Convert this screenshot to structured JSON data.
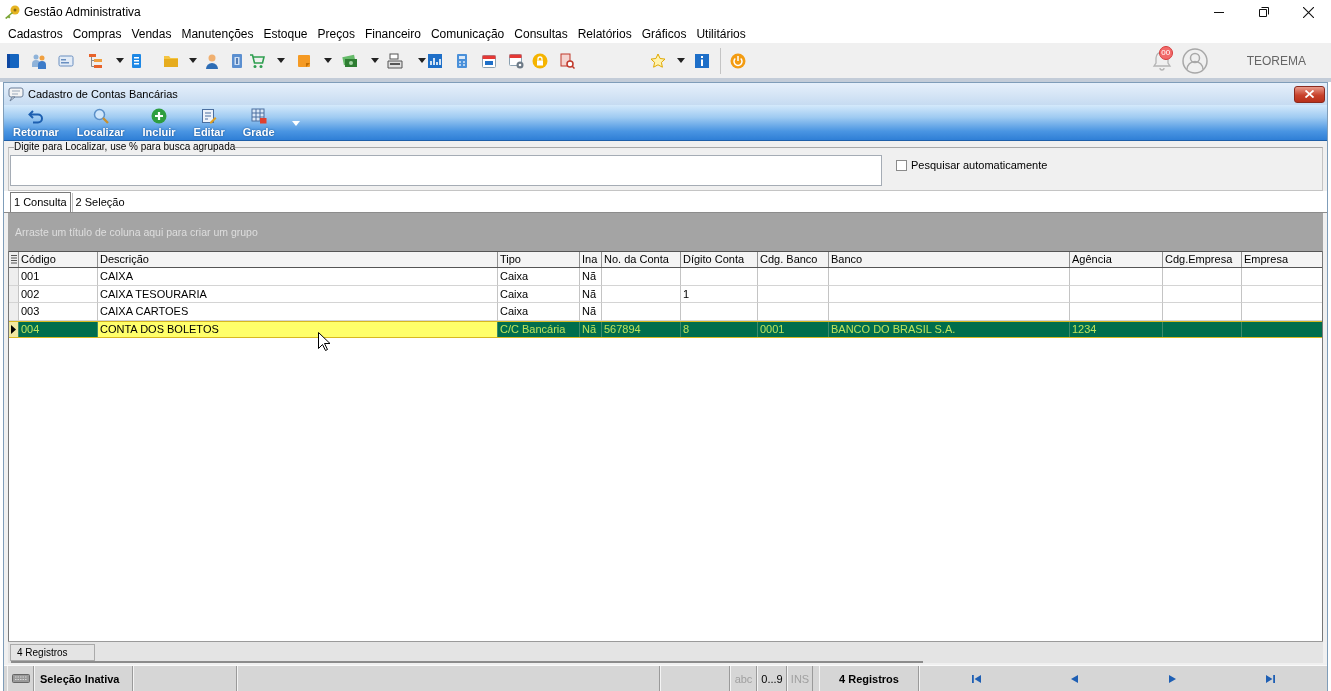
{
  "window": {
    "title": "Gestão Administrativa"
  },
  "menu": [
    "Cadastros",
    "Compras",
    "Vendas",
    "Manutenções",
    "Estoque",
    "Preços",
    "Financeiro",
    "Comunicação",
    "Consultas",
    "Relatórios",
    "Gráficos",
    "Utilitários"
  ],
  "header": {
    "notification_badge": "00",
    "user": "TEOREMA"
  },
  "form": {
    "title": "Cadastro de Contas Bancárias",
    "actions": [
      "Retornar",
      "Localizar",
      "Incluir",
      "Editar",
      "Grade"
    ],
    "search": {
      "label": "Digite para Localizar, use % para busca agrupada"
    },
    "auto_search": {
      "label": "Pesquisar automaticamente",
      "checked": false
    },
    "tabs": [
      {
        "label": "1 Consulta",
        "selected": true
      },
      {
        "label": "2 Seleção",
        "selected": false
      }
    ],
    "group_hint": "Arraste um título de coluna aqui para criar um grupo",
    "table": {
      "columns": [
        {
          "label": "Código",
          "focused": false
        },
        {
          "label": "Descrição",
          "focused": true
        },
        {
          "label": "Tipo",
          "focused": false
        },
        {
          "label": "Ina",
          "focused": false
        },
        {
          "label": "No. da Conta",
          "focused": false
        },
        {
          "label": "Dígito Conta",
          "focused": false
        },
        {
          "label": "Cdg. Banco",
          "focused": false
        },
        {
          "label": "Banco",
          "focused": false
        },
        {
          "label": "Agência",
          "focused": false
        },
        {
          "label": "Cdg.Empresa",
          "focused": false
        },
        {
          "label": "Empresa",
          "focused": false
        }
      ],
      "rows": [
        {
          "selected": false,
          "cells": [
            "001",
            "CAIXA",
            "Caixa",
            "Nã",
            null,
            null,
            null,
            null,
            null,
            null,
            null
          ]
        },
        {
          "selected": false,
          "cells": [
            "002",
            "CAIXA TESOURARIA",
            "Caixa",
            "Nã",
            null,
            "1",
            null,
            null,
            null,
            null,
            null
          ]
        },
        {
          "selected": false,
          "cells": [
            "003",
            "CAIXA CARTOES",
            "Caixa",
            "Nã",
            null,
            null,
            null,
            null,
            null,
            null,
            null
          ]
        },
        {
          "selected": true,
          "cells": [
            "004",
            "CONTA DOS BOLETOS",
            "C/C Bancária",
            "Nã",
            "567894",
            "8",
            "0001",
            "BANCO DO BRASIL S.A.",
            "1234",
            null,
            null
          ]
        }
      ]
    },
    "record_count": "4 Registros"
  },
  "status_bar": {
    "selection": "Seleção Inativa",
    "indicators": [
      {
        "label": "abc",
        "on": false
      },
      {
        "label": "0...9",
        "on": true
      },
      {
        "label": "INS",
        "on": false
      }
    ],
    "count": "4 Registros"
  }
}
